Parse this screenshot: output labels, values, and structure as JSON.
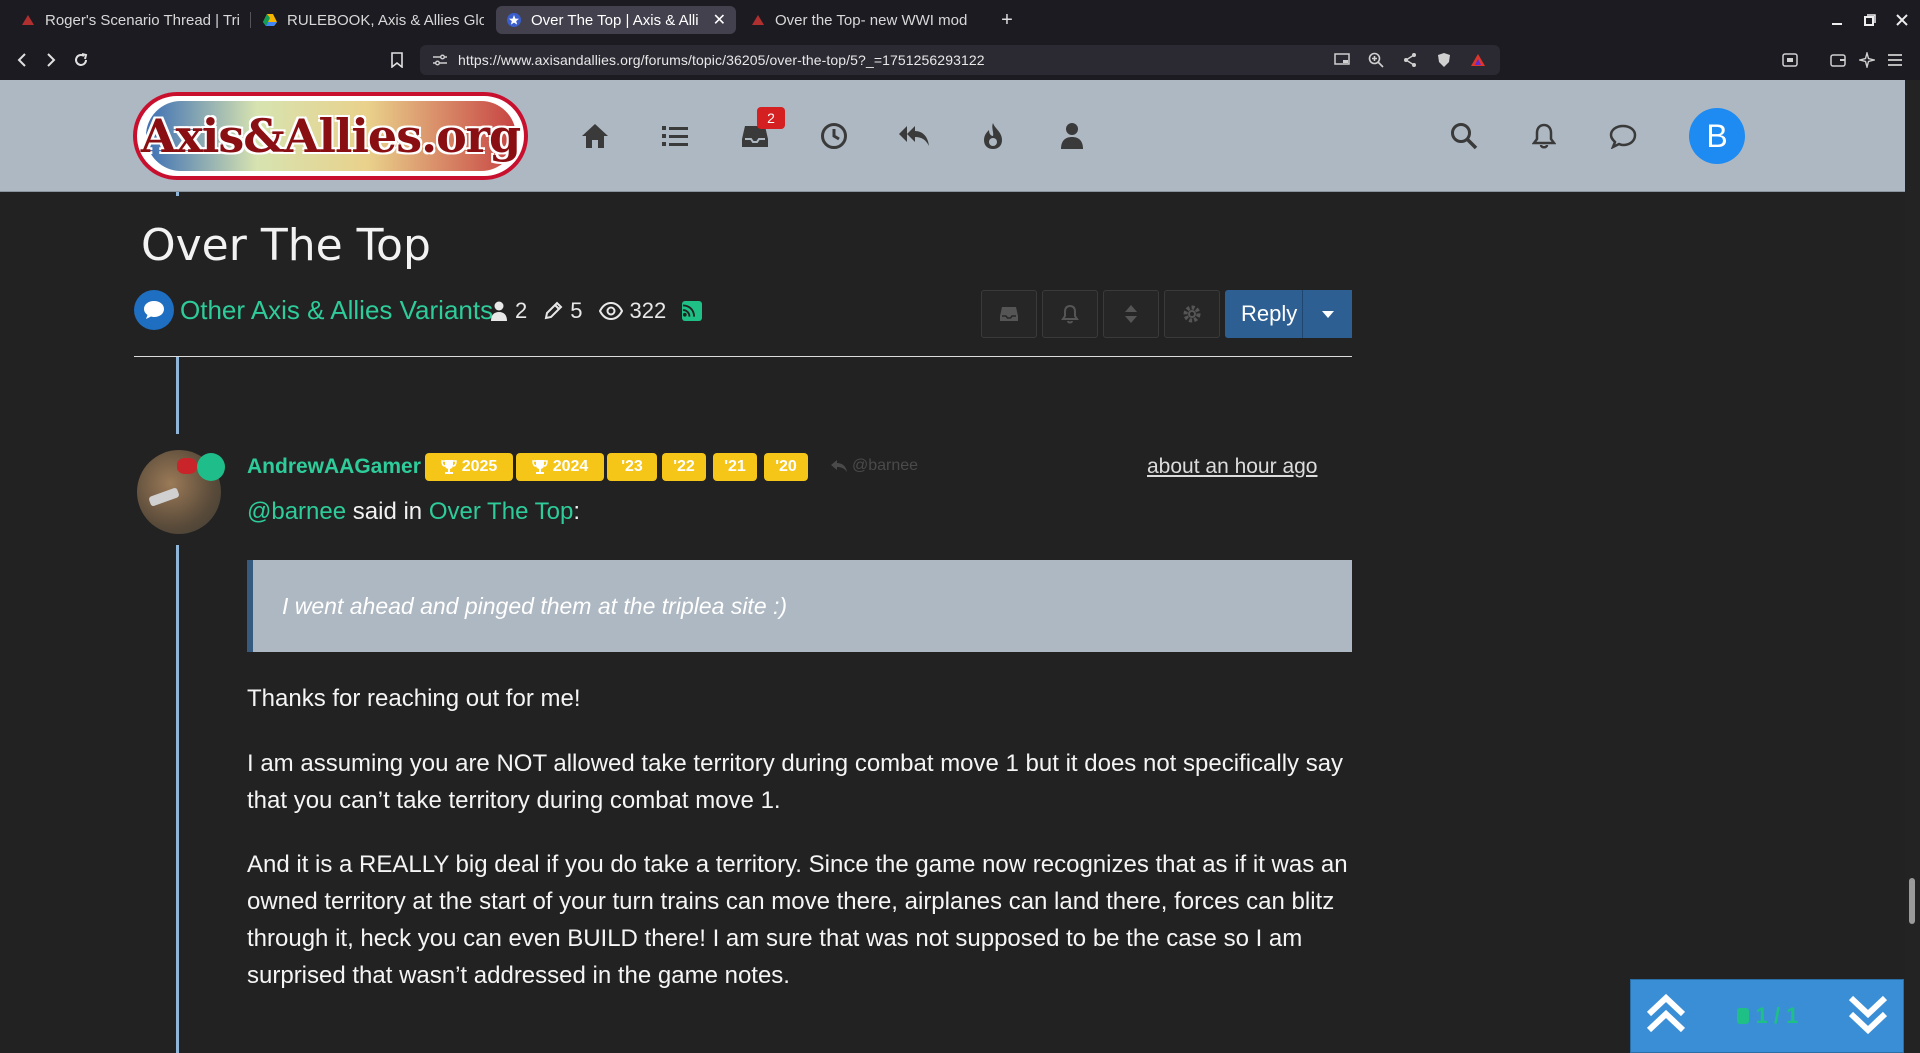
{
  "browser": {
    "tabs": [
      {
        "label": "Roger's Scenario Thread | Tri",
        "active": false,
        "favicon": "axis-allies-icon"
      },
      {
        "label": "RULEBOOK, Axis & Allies Glo",
        "active": false,
        "favicon": "google-drive-icon"
      },
      {
        "label": "Over The Top | Axis & Alli",
        "active": true,
        "favicon": "site-star-icon"
      },
      {
        "label": "Over the Top- new WWI mod",
        "active": false,
        "favicon": "axis-allies-icon"
      }
    ],
    "url": "https://www.axisandallies.org/forums/topic/36205/over-the-top/5?_=1751256293122"
  },
  "site": {
    "logo_text": "Axis&Allies.org",
    "notification_count": "2",
    "user_initial": "B",
    "nav_icons": [
      "home-icon",
      "list-icon",
      "inbox-icon",
      "clock-icon",
      "reply-all-icon",
      "fire-icon",
      "user-icon"
    ]
  },
  "topic": {
    "title": "Over The Top",
    "category": "Other Axis & Allies Variants",
    "posters": "2",
    "posts": "5",
    "views": "322",
    "reply_label": "Reply"
  },
  "post": {
    "author": "AndrewAAGamer",
    "badges": [
      "2025",
      "2024",
      "'23",
      "'22",
      "'21",
      "'20"
    ],
    "reply_to": "@barnee",
    "time": "about an hour ago",
    "quote_user": "@barnee",
    "quote_said_in": " said in ",
    "quote_topic": "Over The Top",
    "quote_colon": ":",
    "quote_text": "I went ahead and pinged them at the triplea site :)",
    "paragraphs": [
      "Thanks for reaching out for me!",
      "I am assuming you are NOT allowed take territory during combat move 1 but it does not specifically say that you can’t take territory during combat move 1.",
      "And it is a REALLY big deal if you do take a territory. Since the game now recognizes that as if it was an owned territory at the start of your turn trains can move there, airplanes can land there, forces can blitz through it, heck you can even BUILD there! I am sure that was not supposed to be the case so I am surprised that wasn’t addressed in the game notes."
    ]
  },
  "pager": {
    "count": "1 / 1"
  },
  "colors": {
    "accent": "#2ecc9a",
    "header_bg": "#aeb8c2",
    "badge_gold": "#f5c518",
    "reply_blue": "#2e5f93"
  }
}
